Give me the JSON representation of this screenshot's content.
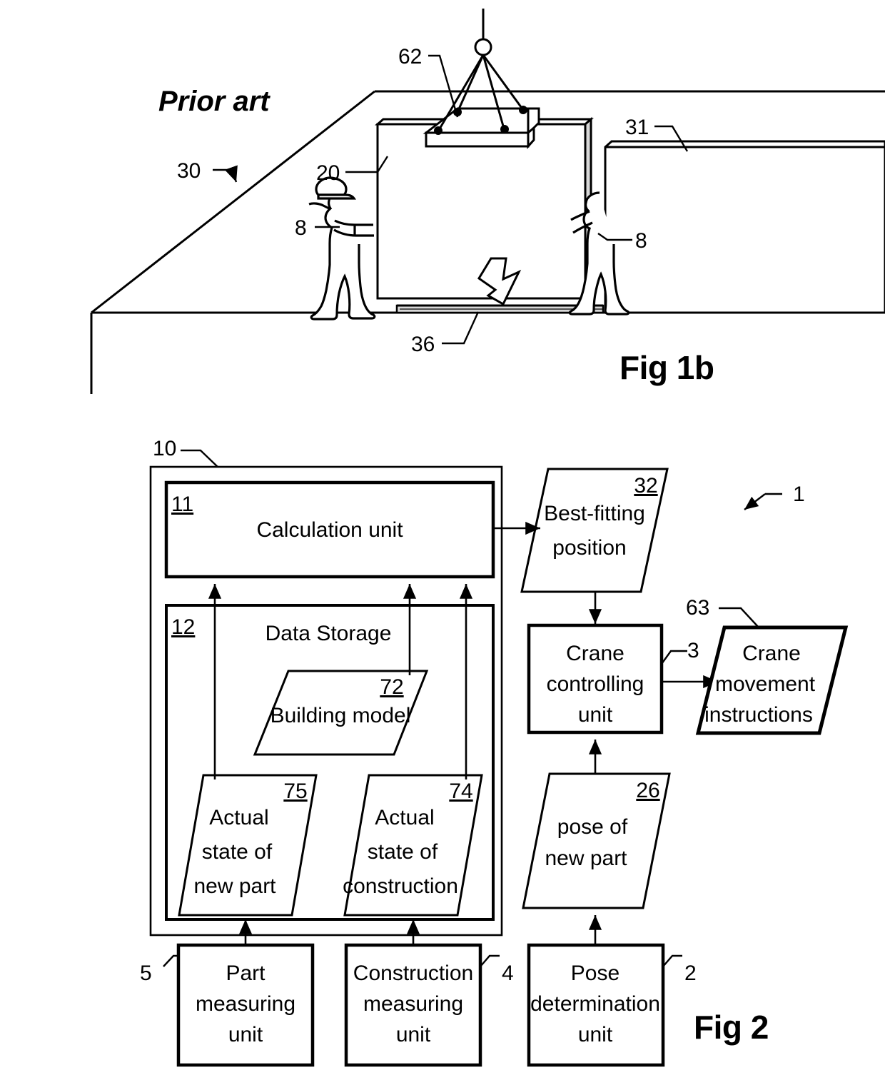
{
  "figure1b": {
    "name": "prior-art-crane-placement",
    "prior_art_label": "Prior art",
    "caption": "Fig 1b",
    "refs": {
      "scene": "30",
      "lifting_frame": "62",
      "new_part": "20",
      "existing_construction": "31",
      "workers": "8",
      "worker_right": "8",
      "slab_edge": "36"
    }
  },
  "figure2": {
    "name": "system-block-diagram",
    "caption": "Fig 2",
    "system_ref": "1",
    "control_system": {
      "ref": "10",
      "calculation_unit": {
        "ref": "11",
        "label": "Calculation unit"
      },
      "data_storage": {
        "ref": "12",
        "label": "Data Storage",
        "items": [
          {
            "ref": "72",
            "label": "Building model"
          },
          {
            "ref": "75",
            "lines": [
              "Actual",
              "state of",
              "new part"
            ]
          },
          {
            "ref": "74",
            "lines": [
              "Actual",
              "state of",
              "construction"
            ]
          }
        ]
      }
    },
    "best_fitting_position": {
      "ref": "32",
      "lines": [
        "Best-fitting",
        "position"
      ]
    },
    "crane_controlling_unit": {
      "ref": "3",
      "lines": [
        "Crane",
        "controlling",
        "unit"
      ]
    },
    "crane_movement_instructions": {
      "ref": "63",
      "lines": [
        "Crane",
        "movement",
        "instructions"
      ]
    },
    "pose_of_new_part": {
      "ref": "26",
      "lines": [
        "pose of",
        "new part"
      ]
    },
    "part_measuring_unit": {
      "ref": "5",
      "lines": [
        "Part",
        "measuring",
        "unit"
      ]
    },
    "construction_measuring_unit": {
      "ref": "4",
      "lines": [
        "Construction",
        "measuring",
        "unit"
      ]
    },
    "pose_determination_unit": {
      "ref": "2",
      "lines": [
        "Pose",
        "determination",
        "unit"
      ]
    }
  },
  "colors": {
    "line": "#000000",
    "fill": "#ffffff",
    "shade": "#d8d8d8"
  }
}
